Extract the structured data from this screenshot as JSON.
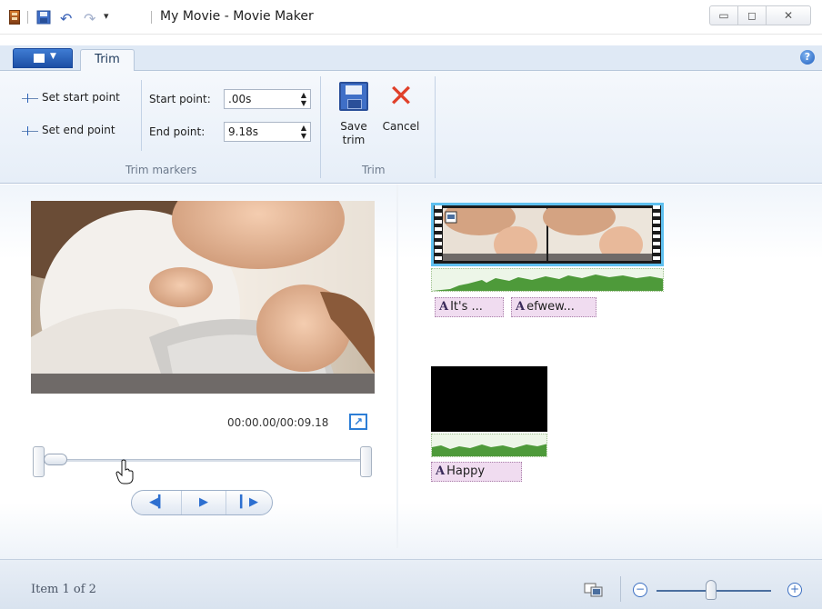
{
  "window": {
    "title": "My Movie - Movie Maker",
    "minimize_glyph": "▭",
    "maximize_glyph": "◻",
    "close_glyph": "✕"
  },
  "quick_access": {
    "icons": [
      "app-icon",
      "save-icon",
      "undo-icon",
      "redo-icon",
      "customize-dropdown-icon"
    ],
    "undo_glyph": "↶",
    "redo_glyph": "↷",
    "dropdown_glyph": "▾"
  },
  "ribbon": {
    "app_menu_glyph": "▼",
    "tabs": [
      {
        "label": "Trim",
        "active": true
      }
    ],
    "help_glyph": "?",
    "trim_markers": {
      "set_start_label": "Set start point",
      "set_end_label": "Set end point",
      "start_point_label": "Start point:",
      "start_point_value": ".00s",
      "end_point_label": "End point:",
      "end_point_value": "9.18s",
      "spin_glyph": "▲\n▼",
      "group_label": "Trim markers"
    },
    "trim": {
      "save_label": "Save trim",
      "cancel_label": "Cancel",
      "cancel_glyph": "✕",
      "group_label": "Trim"
    }
  },
  "preview": {
    "time": "00:00.00/00:09.18",
    "popout_glyph": "↗",
    "controls": {
      "prev_glyph": "◀▎",
      "play_glyph": "▶",
      "next_glyph": "▎▶"
    },
    "trim_start_fraction": 0.0,
    "trim_end_fraction": 1.0,
    "playhead_fraction": 0.0
  },
  "storyboard": {
    "captions": [
      {
        "icon": "A",
        "text": "It's ..."
      },
      {
        "icon": "A",
        "text": "efwew..."
      },
      {
        "icon": "A",
        "text": "Happy"
      }
    ]
  },
  "status": {
    "text": "Item 1 of 2",
    "zoom_minus": "−",
    "zoom_plus": "+"
  },
  "colors": {
    "accent": "#2d6fd0",
    "selection": "#5fc0ef",
    "caption_bg": "#f0dcf0",
    "audio_wave": "#4e9a3a",
    "cancel_red": "#e0402a"
  }
}
